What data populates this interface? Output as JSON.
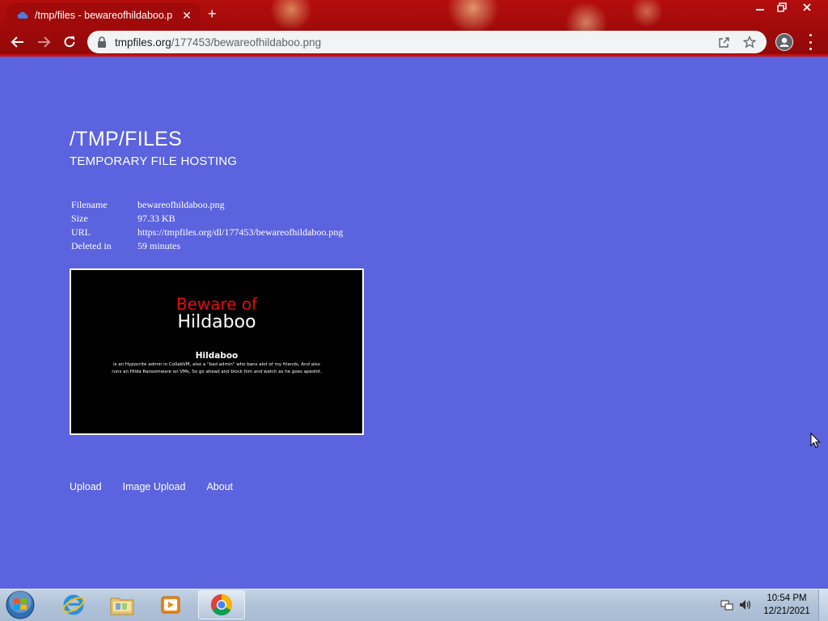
{
  "browser": {
    "tab_title": "/tmp/files - bewareofhildaboo.p",
    "url_host": "tmpfiles.org",
    "url_path": "/177453/bewareofhildaboo.png",
    "new_tab_symbol": "+"
  },
  "site": {
    "title": "/TMP/FILES",
    "subtitle": "TEMPORARY FILE HOSTING"
  },
  "file_info": [
    {
      "label": "Filename",
      "value": "bewareofhildaboo.png"
    },
    {
      "label": "Size",
      "value": "97.33 KB"
    },
    {
      "label": "URL",
      "value": "https://tmpfiles.org/dl/177453/bewareofhildaboo.png"
    },
    {
      "label": "Deleted in",
      "value": "59 minutes"
    }
  ],
  "preview_image": {
    "line1": "Beware of",
    "line2": "Hildaboo",
    "heading": "Hildaboo",
    "body": "is an Hypocrite admin in CollabVM, also a \"bad admin\" who bans alot of my friends, And also runs an Hilda Ransomware on VMs, So go ahead and block him and watch as he goes apeshit."
  },
  "footer": {
    "upload": "Upload",
    "image_upload": "Image Upload",
    "about": "About"
  },
  "taskbar": {
    "time": "10:54 PM",
    "date": "12/21/2021"
  },
  "colors": {
    "page_background": "#5b63de",
    "chrome_red": "#b40d0d"
  }
}
